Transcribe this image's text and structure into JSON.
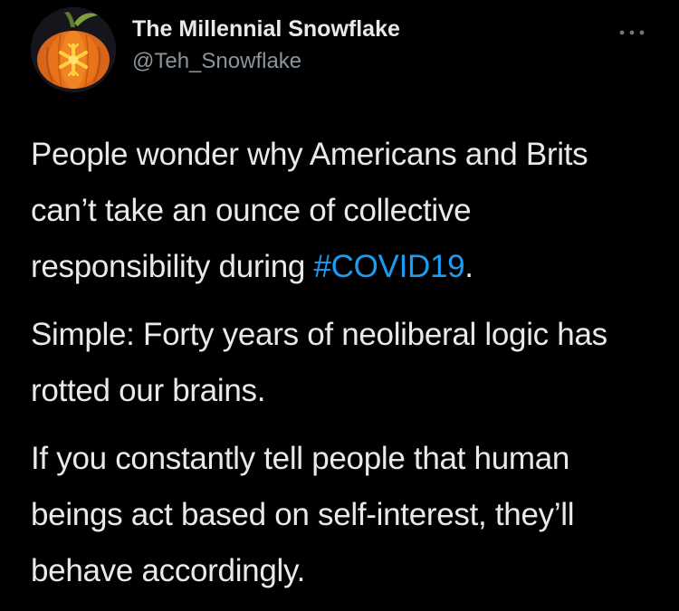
{
  "tweet": {
    "author": {
      "display_name": "The Millennial Snowflake",
      "handle": "@Teh_Snowflake",
      "avatar_icon": "pumpkin-snowflake-avatar"
    },
    "menu_icon": "more-options-icon",
    "paragraph_1": {
      "before": "People wonder why Americans and Brits can’t take an ounce of collective responsibility during ",
      "hashtag": "#COVID19",
      "after": "."
    },
    "paragraph_2": "Simple: Forty years of neoliberal logic has rotted our brains.",
    "paragraph_3": "If you constantly tell people that human beings act based on self-interest, they’ll behave accordingly."
  },
  "colors": {
    "background": "#000000",
    "text": "#e7e9ea",
    "secondary_text": "#8b949b",
    "link": "#1d9bf0",
    "pumpkin": "#e8731a"
  }
}
